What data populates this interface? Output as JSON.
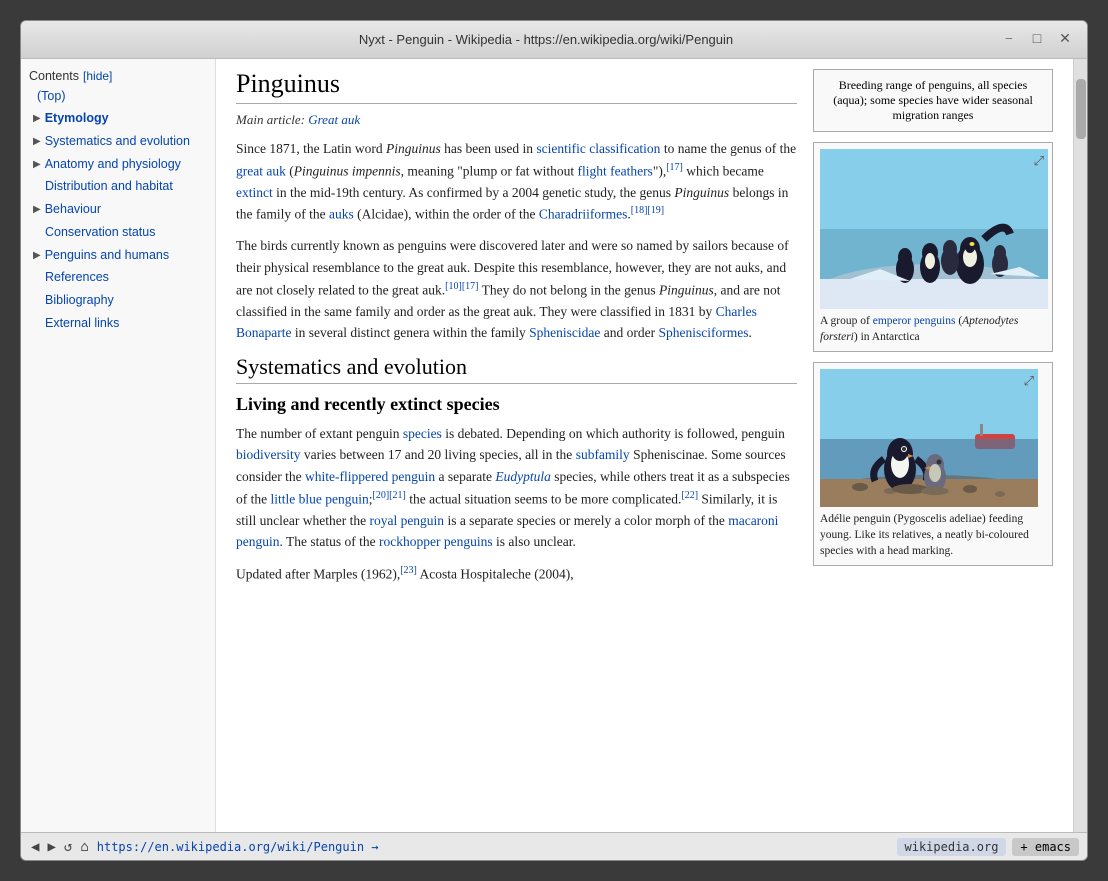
{
  "window": {
    "title": "Nyxt - Penguin - Wikipedia - https://en.wikipedia.org/wiki/Penguin",
    "min_btn": "−",
    "max_btn": "□",
    "close_btn": "✕"
  },
  "sidebar": {
    "contents_label": "Contents",
    "hide_label": "[hide]",
    "top_label": "(Top)",
    "items": [
      {
        "label": "Etymology",
        "bold": true,
        "has_arrow": true,
        "id": "etymology"
      },
      {
        "label": "Systematics and evolution",
        "bold": false,
        "has_arrow": true,
        "id": "systematics"
      },
      {
        "label": "Anatomy and physiology",
        "bold": false,
        "has_arrow": true,
        "id": "anatomy"
      },
      {
        "label": "Distribution and habitat",
        "bold": false,
        "has_arrow": false,
        "id": "distribution"
      },
      {
        "label": "Behaviour",
        "bold": false,
        "has_arrow": true,
        "id": "behaviour"
      },
      {
        "label": "Conservation status",
        "bold": false,
        "has_arrow": false,
        "id": "conservation"
      },
      {
        "label": "Penguins and humans",
        "bold": false,
        "has_arrow": true,
        "id": "humans"
      },
      {
        "label": "References",
        "bold": false,
        "has_arrow": false,
        "id": "references"
      },
      {
        "label": "Bibliography",
        "bold": false,
        "has_arrow": false,
        "id": "bibliography"
      },
      {
        "label": "External links",
        "bold": false,
        "has_arrow": false,
        "id": "external"
      }
    ]
  },
  "article": {
    "heading": "Pinguinus",
    "main_article_prefix": "Main article:",
    "main_article_link": "Great auk",
    "para1": "Since 1871, the Latin word Pinguinus has been used in scientific classification to name the genus of the great auk (Pinguinus impennis, meaning \"plump or fat without flight feathers\"),",
    "para1_ref": "[17]",
    "para1_cont": " which became extinct in the mid-19th century. As confirmed by a 2004 genetic study, the genus Pinguinus belongs in the family of the auks (Alcidae), within the order of the Charadriiformes.",
    "para1_refs": "[18][19]",
    "para2": "The birds currently known as penguins were discovered later and were so named by sailors because of their physical resemblance to the great auk. Despite this resemblance, however, they are not auks, and are not closely related to the great auk.",
    "para2_refs": "[10][17]",
    "para2_cont": " They do not belong in the genus Pinguinus, and are not classified in the same family and order as the great auk. They were classified in 1831 by Charles Bonaparte in several distinct genera within the family Spheniscidae and order Sphenisciformes.",
    "charles_name": "Charles",
    "infobox_text": "Breeding range of penguins, all species (aqua); some species have wider seasonal migration ranges",
    "image1_caption": "A group of emperor penguins (Aptenodytes forsteri) in Antarctica",
    "image1_author_prefix": "A group of",
    "image1_link": "emperor penguins",
    "image1_sci": "(Aptenodytes forsteri)",
    "image1_suffix": "in Antarctica",
    "systematics_title": "Systematics and evolution",
    "living_title": "Living and recently extinct species",
    "para3": "The number of extant penguin species is debated. Depending on which authority is followed, penguin biodiversity varies between 17 and 20 living species, all in the subfamily Spheniscinae. Some sources consider the white-flippered penguin a separate Eudyptula species, while others treat it as a subspecies of the little blue penguin;",
    "para3_refs": "[20][21]",
    "para3_cont": " the actual situation seems to be more complicated.",
    "para3_ref2": "[22]",
    "para3_cont2": " Similarly, it is still unclear whether the royal penguin is a separate species or merely a color morph of the macaroni penguin. The status of the rockhopper penguins is also unclear.",
    "para4": "Updated after Marples (1962),",
    "para4_ref": "[23]",
    "para4_cont": " Acosta Hospitaleche (2004),",
    "image2_caption": "Adélie penguin (Pygoscelis adeliae) feeding young. Like its relatives, a neatly bi-coloured species with a head marking."
  },
  "statusbar": {
    "url": "https://en.wikipedia.org/wiki/Penguin →",
    "domain": "wikipedia.org",
    "emacs_label": "+ emacs"
  }
}
